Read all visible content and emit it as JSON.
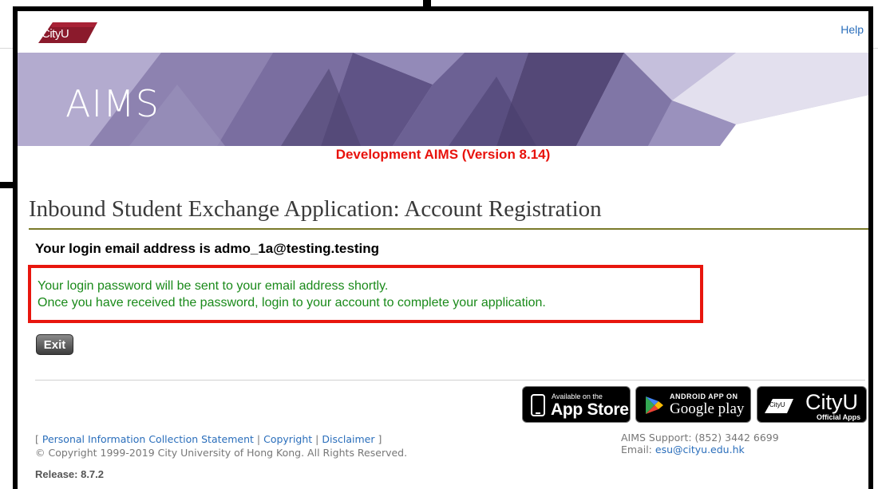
{
  "header": {
    "logo_text": "CityU",
    "help_label": "Help",
    "banner_title": "AIMS",
    "dev_notice": "Development AIMS (Version 8.14)"
  },
  "page": {
    "title": "Inbound Student Exchange Application: Account Registration",
    "email_line": "Your login email address is admo_1a@testing.testing",
    "notice_lines": [
      "Your login password will be sent to your email address shortly.",
      "Once you have received the password, login to your account to complete your application."
    ],
    "exit_label": "Exit"
  },
  "badges": {
    "appstore_small": "Available on the",
    "appstore_big": "App Store",
    "google_small": "ANDROID APP ON",
    "google_big": "Google play",
    "cityu_big": "CityU",
    "cityu_small": "Official Apps",
    "cityu_logo_text": "CityU"
  },
  "footer": {
    "bracket_open": "[",
    "bracket_close": "]",
    "separator": "|",
    "link_privacy": "Personal Information Collection Statement",
    "link_copyright": "Copyright",
    "link_disclaimer": "Disclaimer",
    "copyright_text": "© Copyright 1999-2019 City University of Hong Kong. All Rights Reserved.",
    "release": "Release: 8.7.2",
    "support_line": "AIMS Support: (852) 3442 6699",
    "email_prefix": "Email:",
    "email_link": "esu@cityu.edu.hk"
  },
  "colors": {
    "dev_notice": "#e8120c",
    "notice_text": "#1a8a1a",
    "notice_border": "#e8160e",
    "link": "#2a6ebb",
    "banner": "#9b90bb"
  }
}
